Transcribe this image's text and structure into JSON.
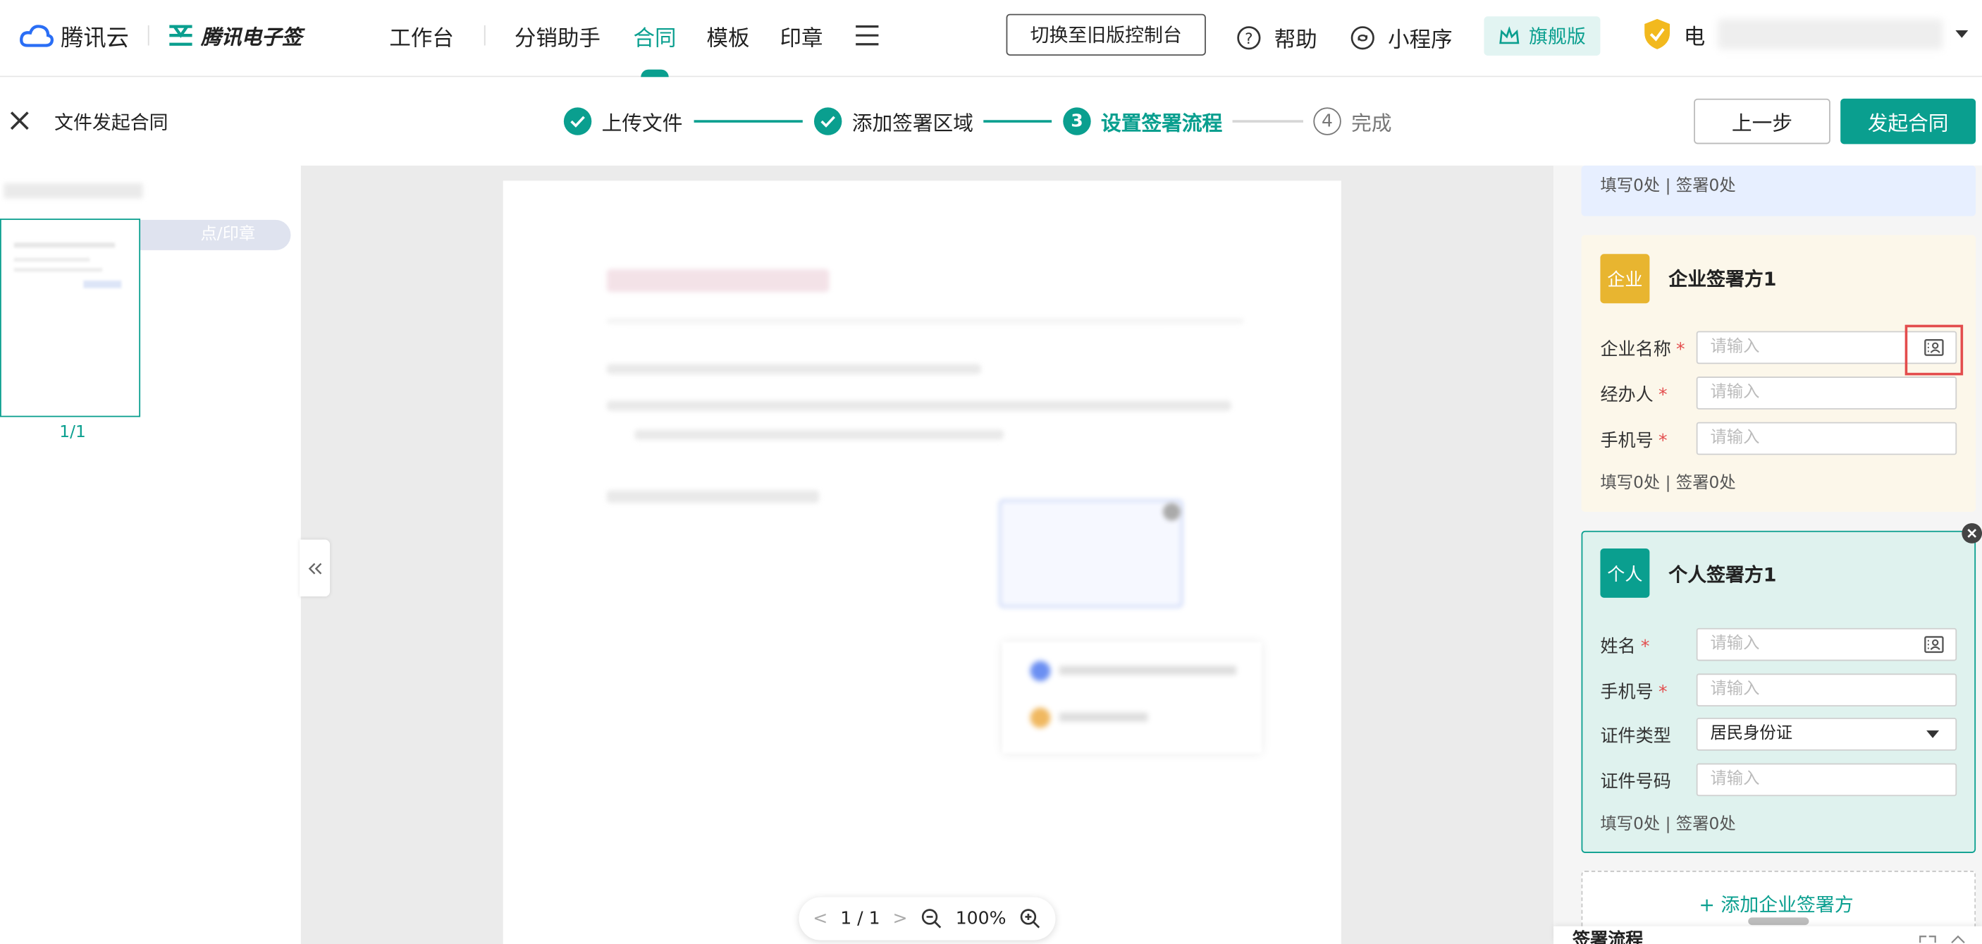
{
  "topbar": {
    "brand1": "腾讯云",
    "brand2": "腾讯电子签",
    "nav": [
      "工作台",
      "分销助手",
      "合同",
      "模板",
      "印章"
    ],
    "active_nav": "合同",
    "switch_label": "切换至旧版控制台",
    "help_label": "帮助",
    "miniprogram_label": "小程序",
    "flagship_label": "旗舰版",
    "company_prefix": "电"
  },
  "subbar": {
    "title": "文件发起合同",
    "steps": [
      {
        "label": "上传文件",
        "state": "done"
      },
      {
        "label": "添加签署区域",
        "state": "done"
      },
      {
        "label": "设置签署流程",
        "state": "current",
        "num": "3"
      },
      {
        "label": "完成",
        "state": "todo",
        "num": "4"
      }
    ],
    "prev_button": "上一步",
    "submit_button": "发起合同"
  },
  "leftpane": {
    "thumb_tag": "点/印章",
    "page_count": "1/1"
  },
  "pager": {
    "page": "1 / 1",
    "zoom": "100%"
  },
  "right": {
    "prev_footer": "填写0处 | 签署0处",
    "enterprise": {
      "badge": "企业",
      "title": "企业签署方1",
      "fields": [
        {
          "label": "企业名称",
          "placeholder": "请输入"
        },
        {
          "label": "经办人",
          "placeholder": "请输入"
        },
        {
          "label": "手机号",
          "placeholder": "请输入"
        }
      ],
      "footer": "填写0处 | 签署0处"
    },
    "personal": {
      "badge": "个人",
      "title": "个人签署方1",
      "fields": [
        {
          "label": "姓名",
          "placeholder": "请输入",
          "required": true
        },
        {
          "label": "手机号",
          "placeholder": "请输入",
          "required": true
        },
        {
          "label": "证件类型",
          "value": "居民身份证",
          "required": false
        },
        {
          "label": "证件号码",
          "placeholder": "请输入",
          "required": false
        }
      ],
      "footer": "填写0处 | 签署0处"
    },
    "add_enterprise": "+ 添加企业签署方",
    "flow_title": "签署流程"
  },
  "colors": {
    "primary": "#0a9f8f",
    "enterprise_badge": "#e8b530",
    "enterprise_bg": "#fcf7ea",
    "personal_bg": "#dff2ee",
    "highlight": "#e34d4d"
  }
}
